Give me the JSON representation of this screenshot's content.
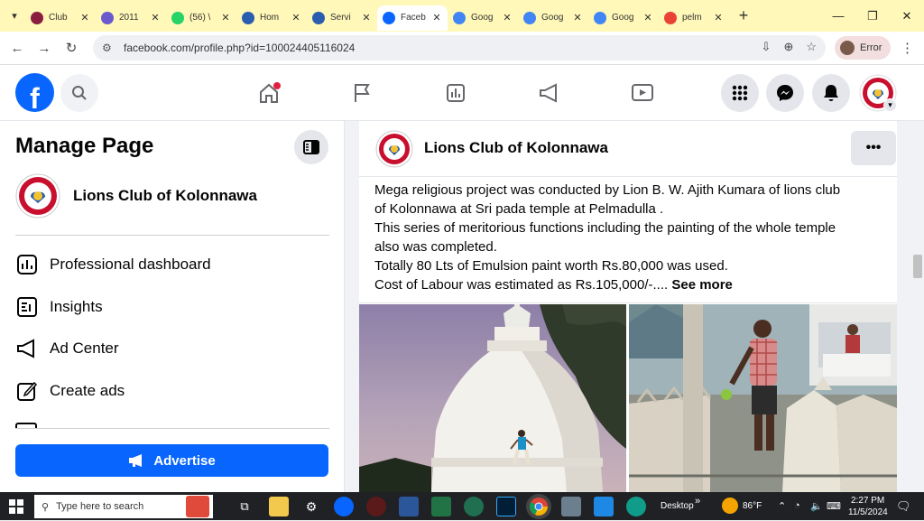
{
  "browser": {
    "tabs": [
      {
        "title": "Club",
        "favicon_color": "#8b1e3f"
      },
      {
        "title": "2011",
        "favicon_color": "#6a5acd"
      },
      {
        "title": "(56) \\",
        "favicon_color": "#25d366"
      },
      {
        "title": "Hom",
        "favicon_color": "#2a5db0"
      },
      {
        "title": "Servi",
        "favicon_color": "#2a5db0"
      },
      {
        "title": "Faceb",
        "favicon_color": "#0866ff",
        "active": true
      },
      {
        "title": "Goog",
        "favicon_color": "#4285f4"
      },
      {
        "title": "Goog",
        "favicon_color": "#4285f4"
      },
      {
        "title": "Goog",
        "favicon_color": "#4285f4"
      },
      {
        "title": "pelm",
        "favicon_color": "#ea4335"
      }
    ],
    "tab_close": "✕",
    "new_tab": "+",
    "url": "facebook.com/profile.php?id=100024405116024",
    "profile_label": "Error"
  },
  "facebook": {
    "logo_letter": "f",
    "left_panel": {
      "title": "Manage Page",
      "page_name": "Lions Club of Kolonnawa",
      "menu": [
        {
          "label": "Professional dashboard",
          "icon": "dashboard-icon"
        },
        {
          "label": "Insights",
          "icon": "insights-icon"
        },
        {
          "label": "Ad Center",
          "icon": "megaphone-icon"
        },
        {
          "label": "Create ads",
          "icon": "edit-icon"
        }
      ],
      "advertise_label": "Advertise"
    },
    "post": {
      "author": "Lions Club of Kolonnawa",
      "more_label": "•••",
      "lines": [
        "Mega religious project was conducted by Lion B. W. Ajith Kumara of lions club",
        "of Kolonnawa at Sri pada temple at Pelmadulla .",
        "This series of meritorious functions including the painting of the whole temple",
        "also was completed.",
        "Totally 80 Lts of Emulsion paint worth Rs.80,000 was used."
      ],
      "last_line": "Cost of Labour was estimated as Rs.105,000/-....",
      "see_more": "See more"
    }
  },
  "taskbar": {
    "search_placeholder": "Type here to search",
    "desktop_label": "Desktop",
    "weather": "86°F",
    "time": "2:27 PM",
    "date": "11/5/2024"
  },
  "colors": {
    "fb_blue": "#0866ff",
    "tabstrip": "#fff8b8"
  }
}
